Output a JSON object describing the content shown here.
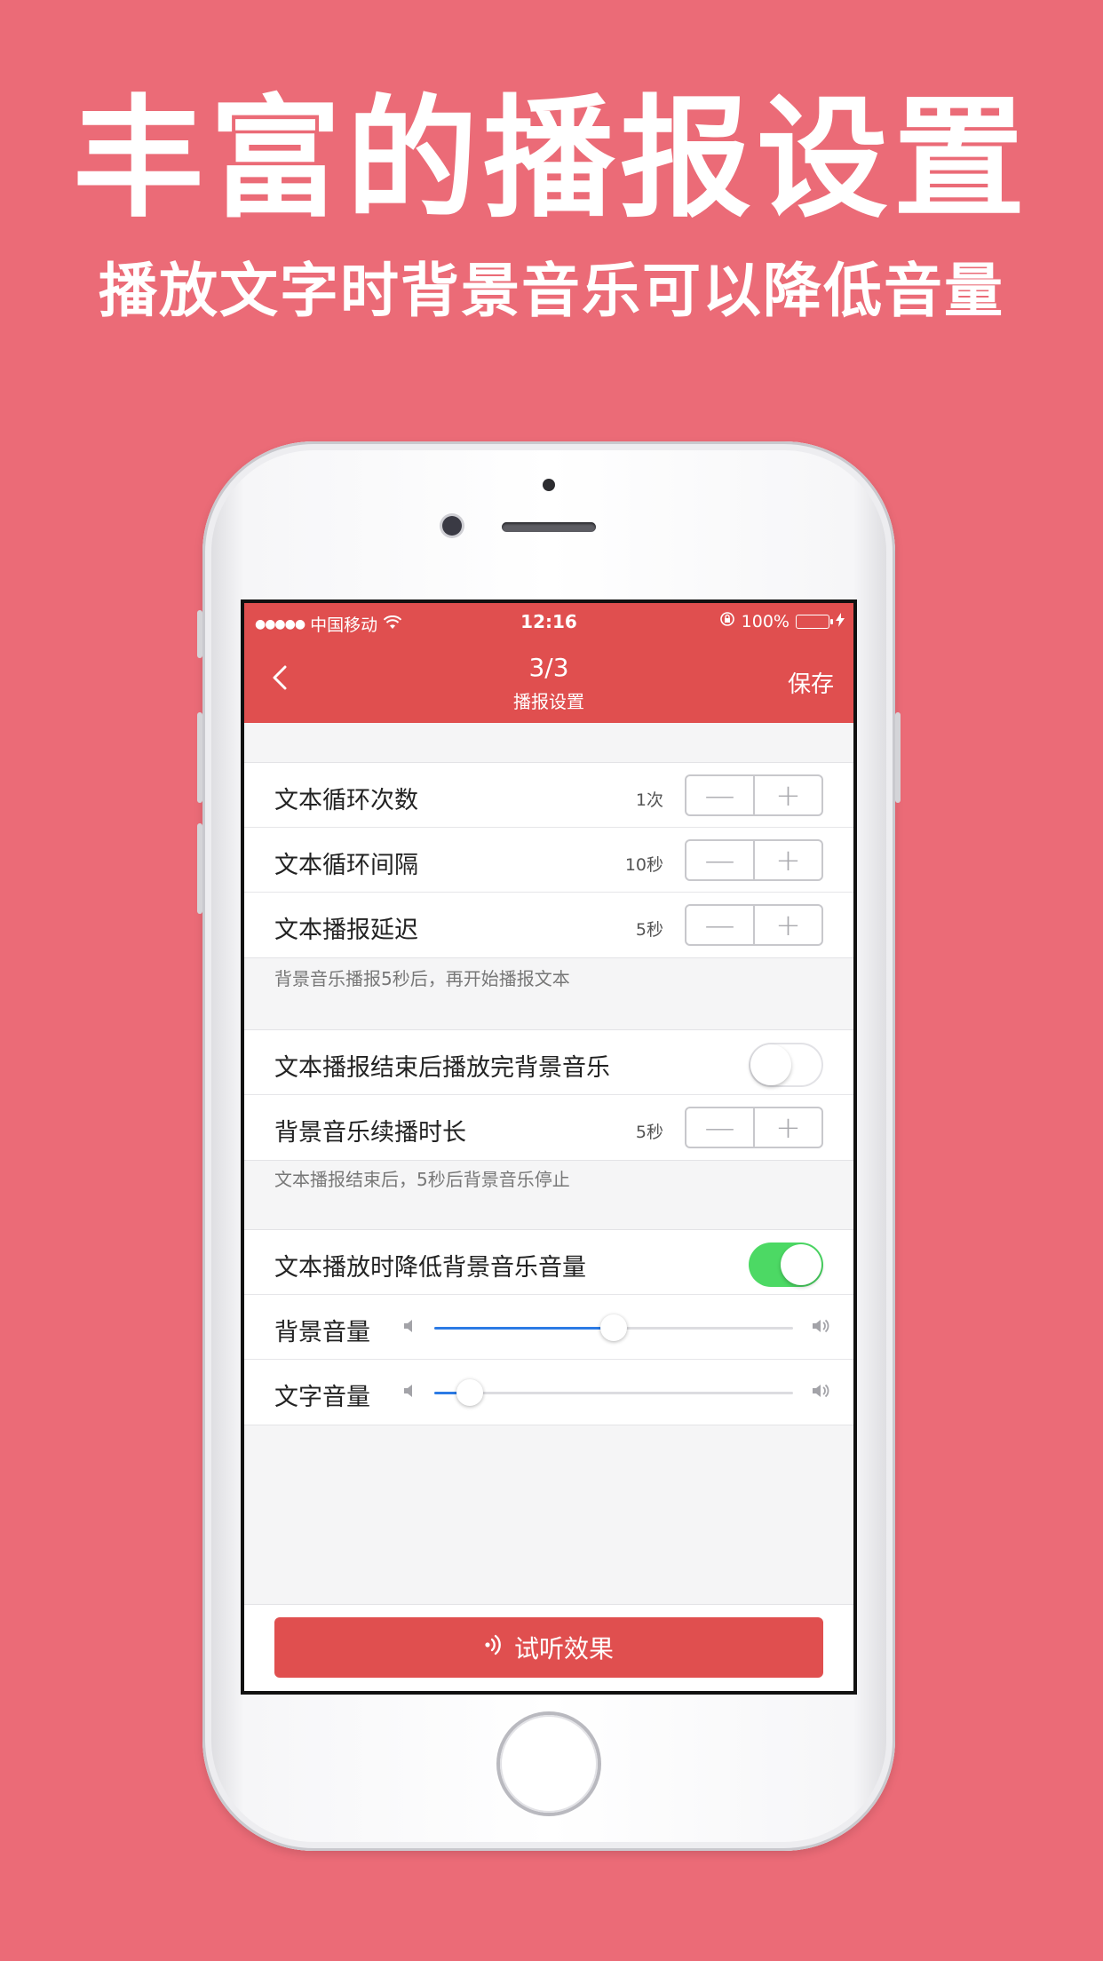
{
  "promo": {
    "headline": "丰富的播报设置",
    "subline": "播放文字时背景音乐可以降低音量"
  },
  "status_bar": {
    "signal": "●●●●●",
    "carrier": "中国移动",
    "time": "12:16",
    "battery": "100%"
  },
  "nav": {
    "step": "3/3",
    "title": "播报设置",
    "save_label": "保存"
  },
  "section1": {
    "rows": [
      {
        "label": "文本循环次数",
        "value": "1次"
      },
      {
        "label": "文本循环间隔",
        "value": "10秒"
      },
      {
        "label": "文本播报延迟",
        "value": "5秒"
      }
    ],
    "note": "背景音乐播报5秒后，再开始播报文本"
  },
  "section2": {
    "toggle_label": "文本播报结束后播放完背景音乐",
    "toggle_on": false,
    "row": {
      "label": "背景音乐续播时长",
      "value": "5秒"
    },
    "note": "文本播报结束后，5秒后背景音乐停止"
  },
  "section3": {
    "toggle_label": "文本播放时降低背景音乐音量",
    "toggle_on": true,
    "sliders": [
      {
        "label": "背景音量",
        "level": 0.5
      },
      {
        "label": "文字音量",
        "level": 0.1
      }
    ]
  },
  "stepper": {
    "minus": "—",
    "plus": "+"
  },
  "listen_button": {
    "label": "试听效果"
  },
  "colors": {
    "background": "#EB6B77",
    "accent": "#E04F4F",
    "switch_on": "#4CD964",
    "slider": "#2C7BE5"
  }
}
